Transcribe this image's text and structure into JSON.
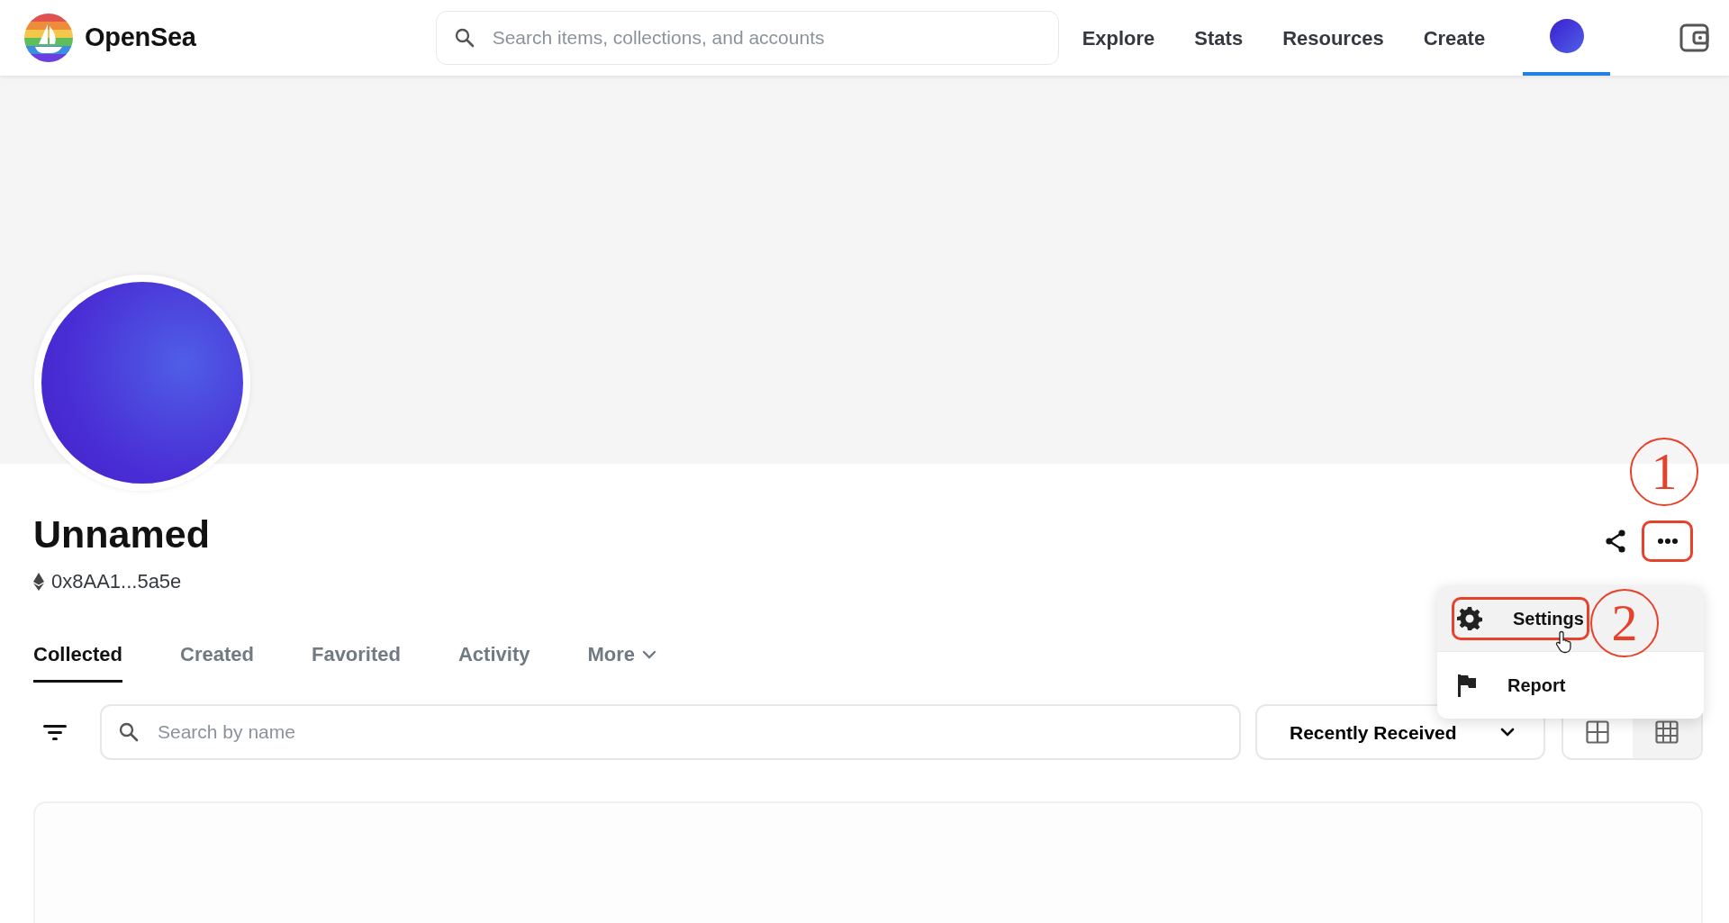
{
  "header": {
    "logo_text": "OpenSea",
    "search": {
      "placeholder": "Search items, collections, and accounts"
    },
    "nav": [
      {
        "label": "Explore"
      },
      {
        "label": "Stats"
      },
      {
        "label": "Resources"
      },
      {
        "label": "Create"
      }
    ],
    "account_tab": {
      "selected": true
    }
  },
  "profile": {
    "name": "Unnamed",
    "address": "0x8AA1...5a5e"
  },
  "more_button": {
    "highlighted": true
  },
  "tabs": [
    {
      "label": "Collected",
      "kind": "tab",
      "selected": true
    },
    {
      "label": "Created",
      "kind": "tab",
      "selected": false
    },
    {
      "label": "Favorited",
      "kind": "tab",
      "selected": false
    },
    {
      "label": "Activity",
      "kind": "tab",
      "selected": false
    },
    {
      "label": "More",
      "kind": "dropdown",
      "selected": false
    }
  ],
  "menu": {
    "items": [
      {
        "label": "Settings",
        "kind": "settings",
        "hovered": true,
        "highlighted": true
      },
      {
        "label": "Report",
        "kind": "report",
        "hovered": false,
        "highlighted": false
      }
    ]
  },
  "toolbar": {
    "search": {
      "placeholder": "Search by name"
    },
    "sort": {
      "value": "Recently Received"
    },
    "view_options": [
      {
        "kind": "large-grid",
        "selected": false
      },
      {
        "kind": "small-grid",
        "selected": true
      }
    ]
  },
  "annotations": [
    {
      "label": "1"
    },
    {
      "label": "2"
    }
  ]
}
